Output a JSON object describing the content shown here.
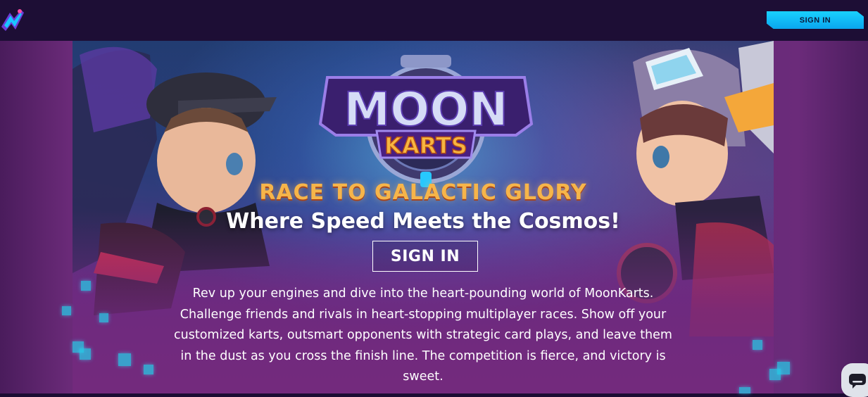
{
  "header": {
    "sign_in_label": "SIGN IN"
  },
  "hero": {
    "logo_line1": "MOON",
    "logo_line2": "KARTS",
    "headline": "RACE TO GALACTIC GLORY",
    "subheadline": "Where Speed Meets the Cosmos!",
    "sign_in_label": "SIGN IN",
    "description": "Rev up your engines and dive into the heart-pounding world of MoonKarts. Challenge friends and rivals in heart-stopping multiplayer races. Show off your customized karts, outsmart opponents with strategic card plays, and leave them in the dust as you cross the finish line. The competition is fierce, and victory is sweet."
  },
  "colors": {
    "header_bg": "#1d0e35",
    "accent_cyan": "#19d1ff",
    "headline_orange": "#f6b54a"
  },
  "icons": {
    "site_logo": "game-logo-icon",
    "chat": "chat-bubble-icon"
  }
}
